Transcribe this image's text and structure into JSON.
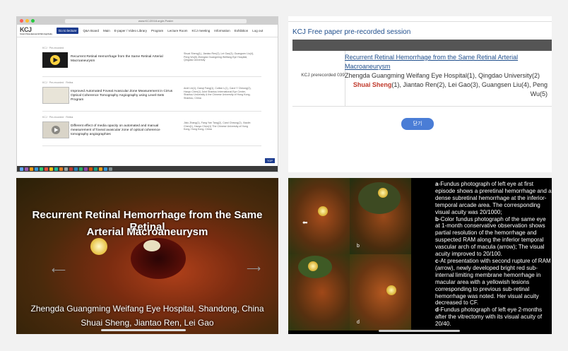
{
  "browser": {
    "url": "www.KCJ2018.org/e-Poster",
    "tab_title": "KCJ 2018 e-Poster",
    "nav": [
      "Q&A Board",
      "Main",
      "E-paper / Video Library",
      "Program",
      "Lecture Room",
      "KCJ meeting",
      "Information",
      "Exhibition",
      "Log out"
    ],
    "go_label": "Go to lecture",
    "logo": "KCJ",
    "logo_sub": "Korean-Chinese-Japanese Ophthalmology Meeting",
    "items": [
      {
        "tag": "KCJ · Pre-recorded",
        "title": "Recurrent Retinal Hemorrhage from the Same Retinal Arterial Macroaneurysm",
        "authors": "Shuai Sheng(1), Jiantao Ren(2), Lei Gao(3), Guangsen Liu(4), Peng Wu(5) Zhengda Guangming Weifang Eye Hospital, Qingdao University"
      },
      {
        "tag": "KCJ · Pre-recorded · Retina",
        "title": "Improved Automated Foveal Avascular Zone Measurement in Cirrus Optical Coherence Tomography Angiography using Level-Sets Program",
        "authors": "Andi Lin(1), Danqi Fang(1), Cuilian L(1), Carol Y Cheung(2), Haoyu Chen(1) Joint Shantou International Eye Center, Shantou University & the Chinese University of Hong Kong, Shantou, China"
      },
      {
        "tag": "KCJ · Pre-recorded · Retina",
        "title": "Different effect of media opacity on automated and manual measurement of foveal avascular zone of optical coherence tomography angiographies",
        "authors": "Jiziu Zhang(1), Fang Yan Tang(2), Carol Cheung(2), Xiaolin Chen(1), Haoyu Chen(1) The Chinese University of Hong Kong, Hong Kong, China"
      }
    ],
    "top_label": "TOP"
  },
  "session": {
    "header": "KCJ Free paper pre-recorded session",
    "row_label": "KCJ prerecorded 039",
    "title": "Recurrent Retinal Hemorrhage from the Same Retinal Arterial Macroaneurysm",
    "affiliation": "Zhengda Guangming Weifang Eye Hospital(1), Qingdao University(2)",
    "presenter": "Shuai Sheng",
    "authors_rest": "(1), Jiantao Ren(2), Lei Gao(3), Guangsen Liu(4), Peng Wu(5)",
    "close_label": "닫기"
  },
  "video": {
    "title_line1": "Recurrent Retinal Hemorrhage from the Same Retinal",
    "title_line2": "Arterial Macroaneurysm",
    "hospital": "Zhengda Guangming Weifang Eye Hospital, Shandong, China",
    "authors": "Shuai Sheng, Jiantao Ren, Lei Gao"
  },
  "figure": {
    "labels": [
      "b",
      "d"
    ],
    "caption": [
      {
        "k": "a",
        "t": "-Fundus photograph of left eye at first episode shows a preretinal hemorrhage and a dense subretinal hemorrhage at the inferior-temporal arcade area. The corresponding visual acuity was 20/1000;"
      },
      {
        "k": "b",
        "t": "-Color fundus photograph of the same eye at 1-month conservative observation shows partial resolution of the hemorrhage and suspected RAM along the inferior temporal vascular arch of macula (arrow); The visual acuity improved to 20/100."
      },
      {
        "k": "c",
        "t": "-At presentation with second rupture of RAM (arrow), newly developed bright red sub-internal limiting membrane hemorrhage in macular area with a yellowish lesions corresponding to previous sub-retinal hemorrhage was noted. Her visual acuity decreased to CF."
      },
      {
        "k": "d",
        "t": "-Fundus photograph of left eye 2-months after the vitrectomy with its visual acuity of 20/40."
      }
    ]
  }
}
